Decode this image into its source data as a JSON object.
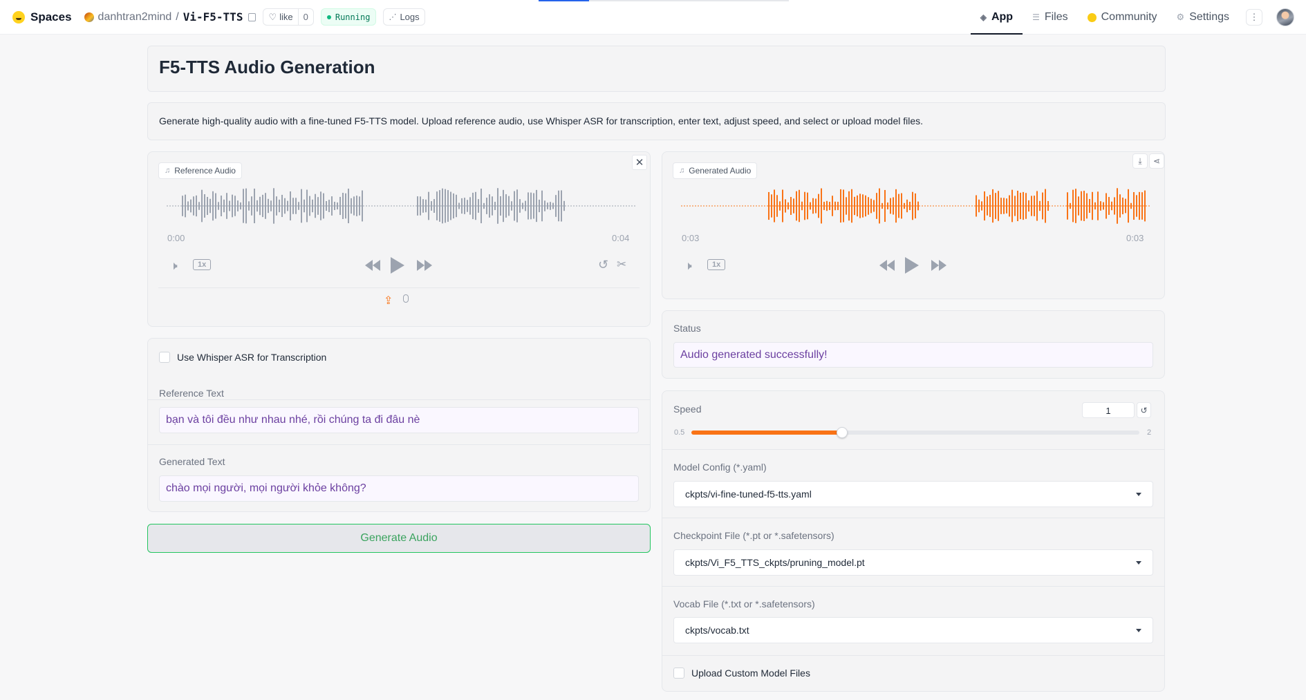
{
  "nav": {
    "brand": "Spaces",
    "owner": "danhtran2mind",
    "separator": "/",
    "repo": "Vi-F5-TTS",
    "like_label": "like",
    "like_count": "0",
    "status": "Running",
    "logs_label": "Logs",
    "tabs": [
      {
        "label": "App",
        "icon": "app-icon",
        "active": true
      },
      {
        "label": "Files",
        "icon": "files-icon"
      },
      {
        "label": "Community",
        "icon": "community-icon"
      },
      {
        "label": "Settings",
        "icon": "gear-icon"
      }
    ],
    "menu_icon": "⋮"
  },
  "app": {
    "title": "F5-TTS Audio Generation",
    "description": "Generate high-quality audio with a fine-tuned F5-TTS model. Upload reference audio, use Whisper ASR for transcription, enter text, adjust speed, and select or upload model files."
  },
  "reference_audio": {
    "label": "Reference Audio",
    "time_start": "0:00",
    "time_end": "0:04",
    "rate": "1x",
    "wave_color": "#9ca3af"
  },
  "generated_audio": {
    "label": "Generated Audio",
    "time_start": "0:03",
    "time_end": "0:03",
    "rate": "1x",
    "wave_color": "#f97316"
  },
  "whisper": {
    "label": "Use Whisper ASR for Transcription"
  },
  "reference_text": {
    "label": "Reference Text",
    "value": "bạn và tôi đều như nhau nhé, rồi chúng ta đi đâu nè"
  },
  "generated_text": {
    "label": "Generated Text",
    "value": "chào mọi người, mọi người khỏe không?"
  },
  "generate_button": "Generate Audio",
  "status": {
    "label": "Status",
    "value": "Audio generated successfully!"
  },
  "speed": {
    "label": "Speed",
    "value": "1",
    "min": "0.5",
    "max": "2",
    "fraction": 0.337
  },
  "model_config": {
    "label": "Model Config (*.yaml)",
    "value": "ckpts/vi-fine-tuned-f5-tts.yaml"
  },
  "checkpoint": {
    "label": "Checkpoint File (*.pt or *.safetensors)",
    "value": "ckpts/Vi_F5_TTS_ckpts/pruning_model.pt"
  },
  "vocab": {
    "label": "Vocab File (*.txt or *.safetensors)",
    "value": "ckpts/vocab.txt"
  },
  "upload_custom": {
    "label": "Upload Custom Model Files"
  },
  "colors": {
    "accent": "#f97316",
    "text_value": "#6b3fa0",
    "button_border": "#22c55e"
  }
}
